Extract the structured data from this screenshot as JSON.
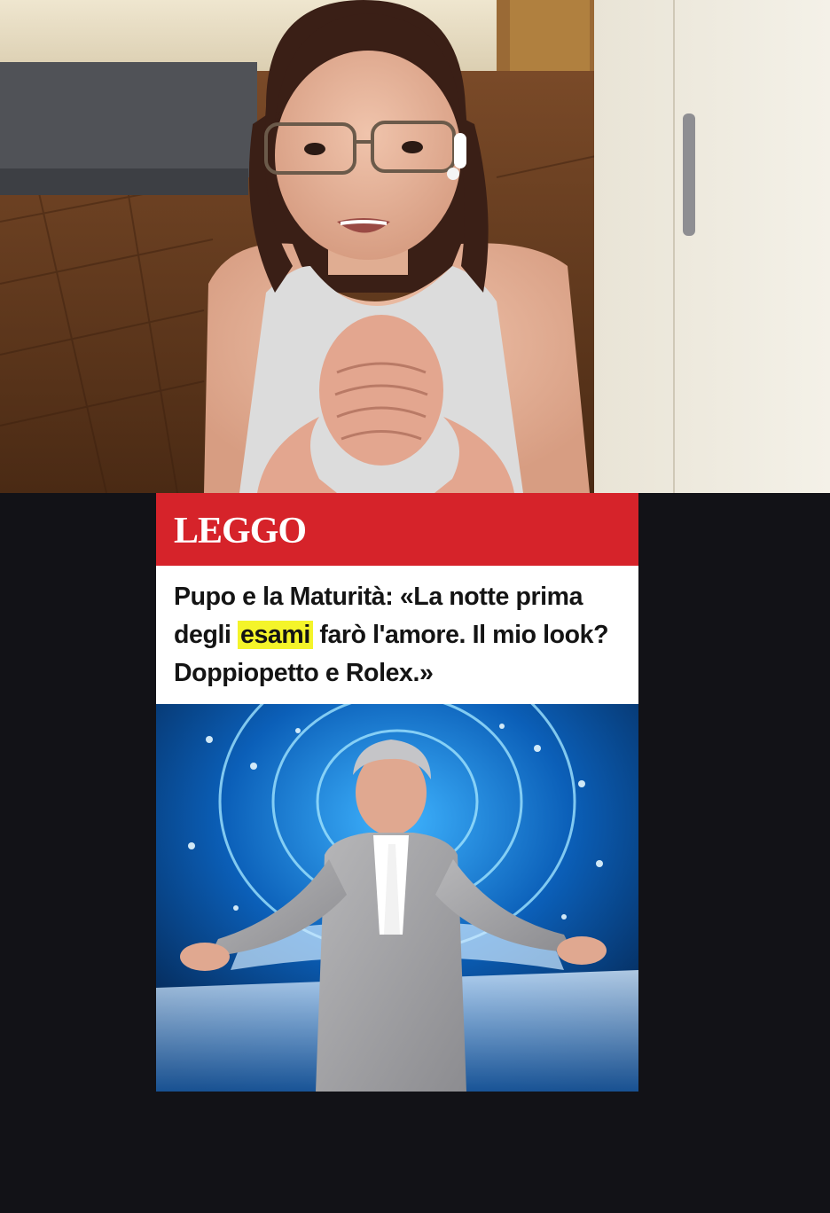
{
  "video": {
    "description_label": ""
  },
  "article": {
    "brand": "LEGGO",
    "headline": {
      "part1": "Pupo e la Maturità: «La notte prima degli ",
      "highlight": "esami",
      "part2": " farò l'amore. Il mio look? Doppiopetto e Rolex.»"
    },
    "colors": {
      "brand_bar": "#d6232a",
      "highlight": "#f4f42a",
      "page_background": "#121217"
    }
  }
}
